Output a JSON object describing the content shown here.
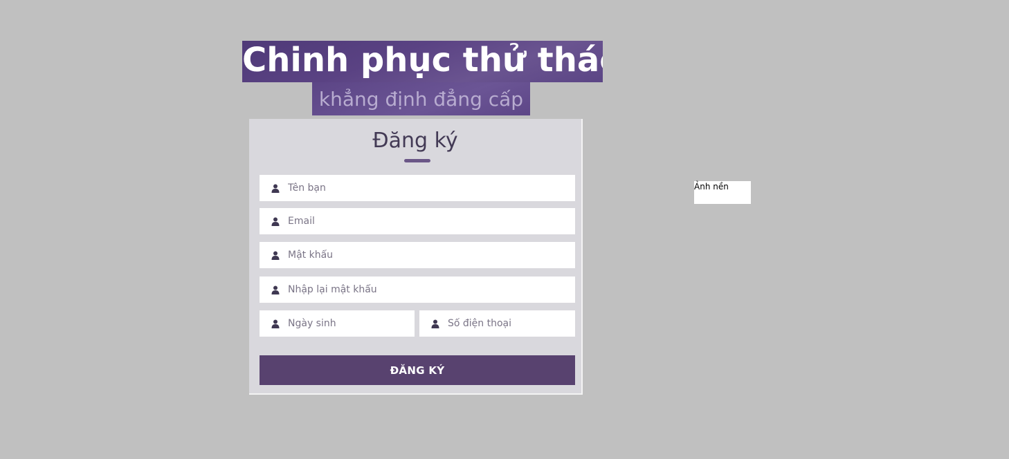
{
  "hero": {
    "title": "Chinh phục thử thách",
    "subtitle": "khẳng định đẳng cấp"
  },
  "form": {
    "title": "Đăng ký",
    "fields": {
      "name": {
        "placeholder": "Tên bạn",
        "icon": "user-icon"
      },
      "email": {
        "placeholder": "Email",
        "icon": "user-icon"
      },
      "password": {
        "placeholder": "Mật khẩu",
        "icon": "user-icon"
      },
      "confirm_password": {
        "placeholder": "Nhập lại mật khẩu",
        "icon": "user-icon"
      },
      "birthday": {
        "placeholder": "Ngày sinh",
        "icon": "user-icon"
      },
      "phone": {
        "placeholder": "Số điện thoại",
        "icon": "user-icon"
      }
    },
    "submit_label": "ĐĂNG KÝ"
  },
  "background_image": {
    "alt": "Ảnh nền"
  },
  "colors": {
    "page_bg": "#c0c0c0",
    "accent": "#58426f",
    "panel_bg": "#d9d8dd",
    "icon": "#3f3852"
  }
}
